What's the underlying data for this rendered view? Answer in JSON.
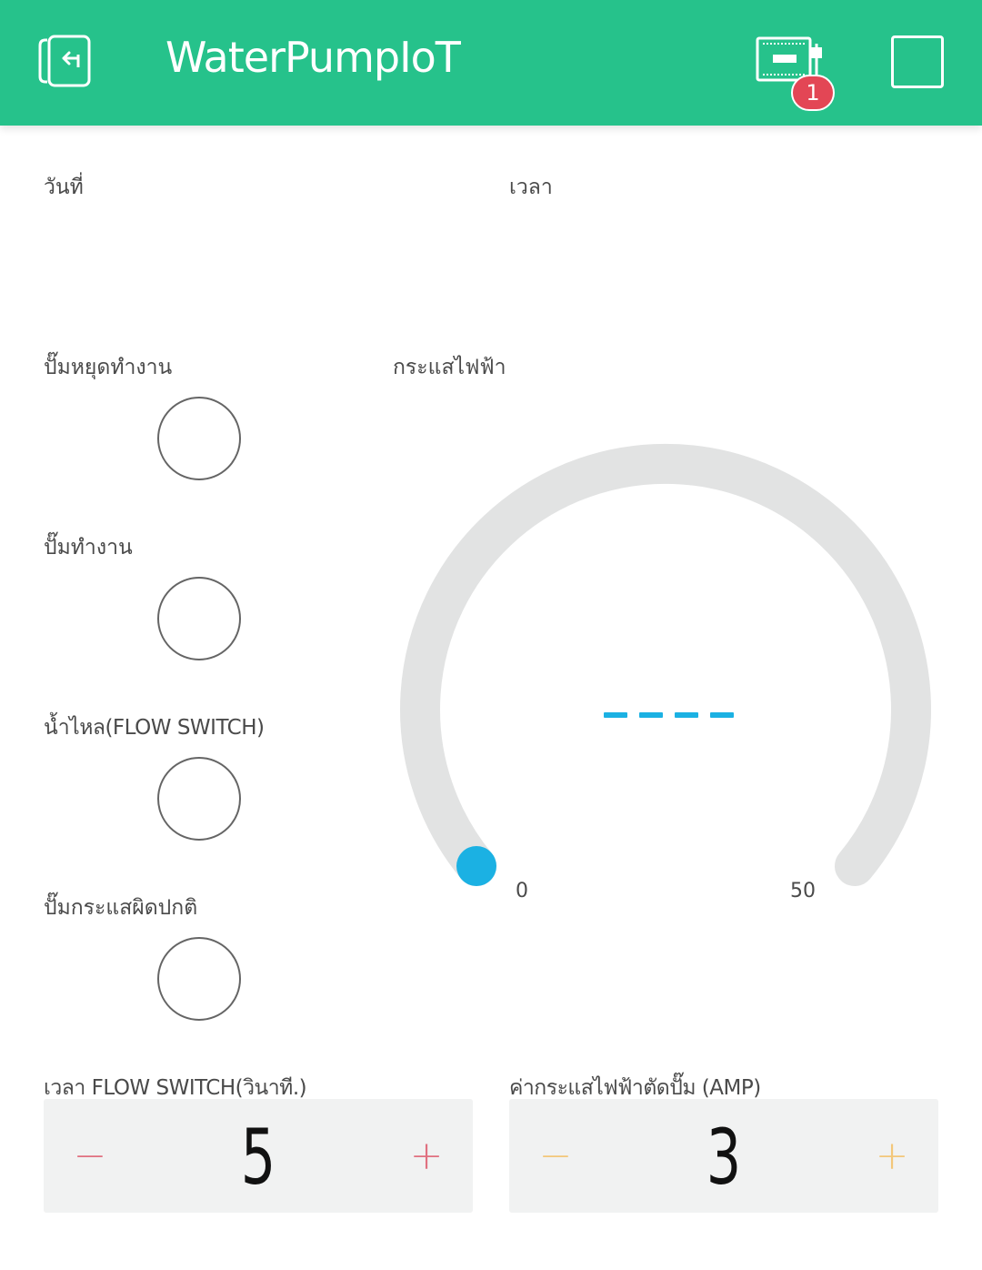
{
  "app": {
    "title": "WaterPumpIoT",
    "accent_color": "#26c28b",
    "badge_count": "1",
    "back_icon": "exit-icon",
    "device_icon": "device-board-icon",
    "menu_icon": "square-icon"
  },
  "labels": {
    "date": "วันที่",
    "time": "เวลา",
    "pump_stop": "ปั๊มหยุดทำงาน",
    "pump_run": "ปั๊มทำงาน",
    "water_flow": "น้ำไหล(FLOW SWITCH)",
    "pump_overcurrent": "ปั๊มกระแสผิดปกติ",
    "current": "กระแสไฟฟ้า",
    "flow_switch_time": "เวลา FLOW SWITCH(วินาที.)",
    "cutoff_current": "ค่ากระแสไฟฟ้าตัดปั๊ม (AMP)"
  },
  "gauge": {
    "min": "0",
    "max": "50",
    "value_display": "----",
    "fill_fraction": 0,
    "track_color": "#e2e3e3",
    "value_color": "#1bb1e3"
  },
  "steppers": {
    "flow_time": {
      "value": "5",
      "minus": "−",
      "plus": "+",
      "color": "#e07080"
    },
    "cutoff": {
      "value": "3",
      "minus": "−",
      "plus": "+",
      "color": "#f3c77a"
    }
  }
}
